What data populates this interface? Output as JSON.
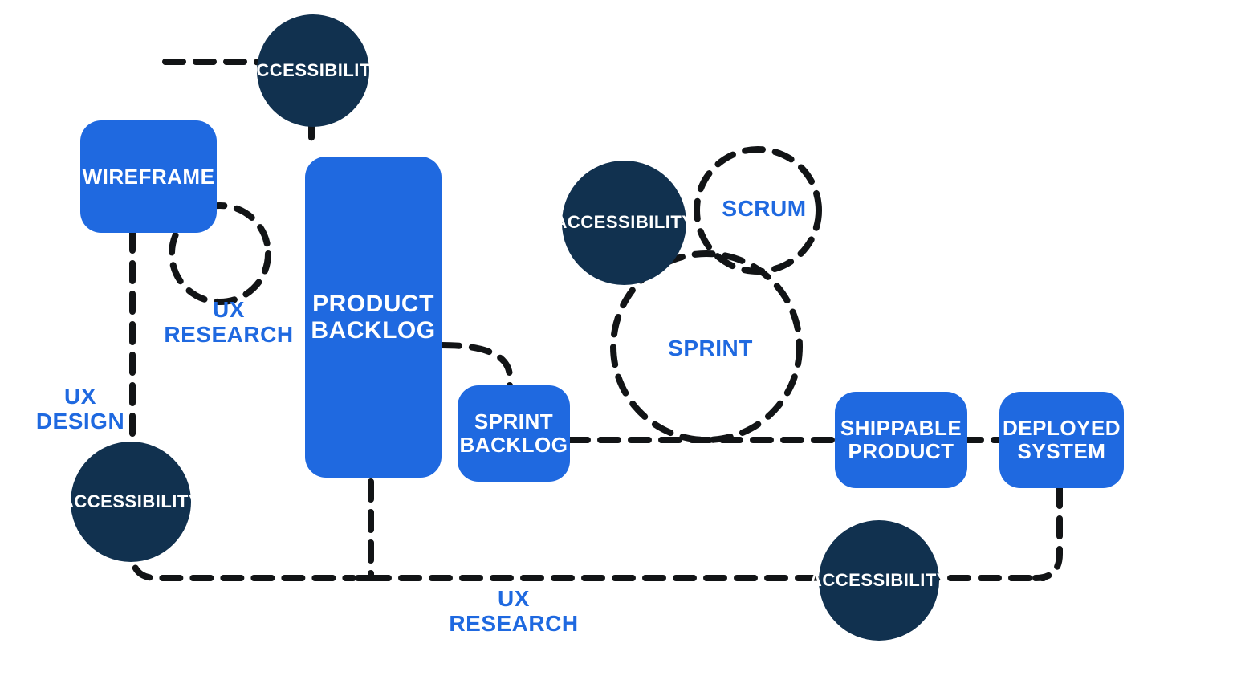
{
  "colors": {
    "blue": "#1F69E0",
    "navy": "#11314F",
    "dash": "#121416",
    "white": "#FFFFFF"
  },
  "nodes": {
    "wireframe": "WIREFRAME",
    "product_backlog_l1": "PRODUCT",
    "product_backlog_l2": "BACKLOG",
    "sprint_backlog_l1": "SPRINT",
    "sprint_backlog_l2": "BACKLOG",
    "shippable_l1": "SHIPPABLE",
    "shippable_l2": "PRODUCT",
    "deployed_l1": "DEPLOYED",
    "deployed_l2": "SYSTEM",
    "access_top": "ACCESSIBILITY",
    "access_left": "ACCESSIBILITY",
    "access_mid": "ACCESSIBILITY",
    "access_bottom": "ACCESSIBILITY"
  },
  "labels": {
    "ux_research_top_l1": "UX",
    "ux_research_top_l2": "RESEARCH",
    "ux_design_l1": "UX",
    "ux_design_l2": "DESIGN",
    "ux_research_bottom_l1": "UX",
    "ux_research_bottom_l2": "RESEARCH",
    "scrum": "SCRUM",
    "sprint": "SPRINT"
  }
}
